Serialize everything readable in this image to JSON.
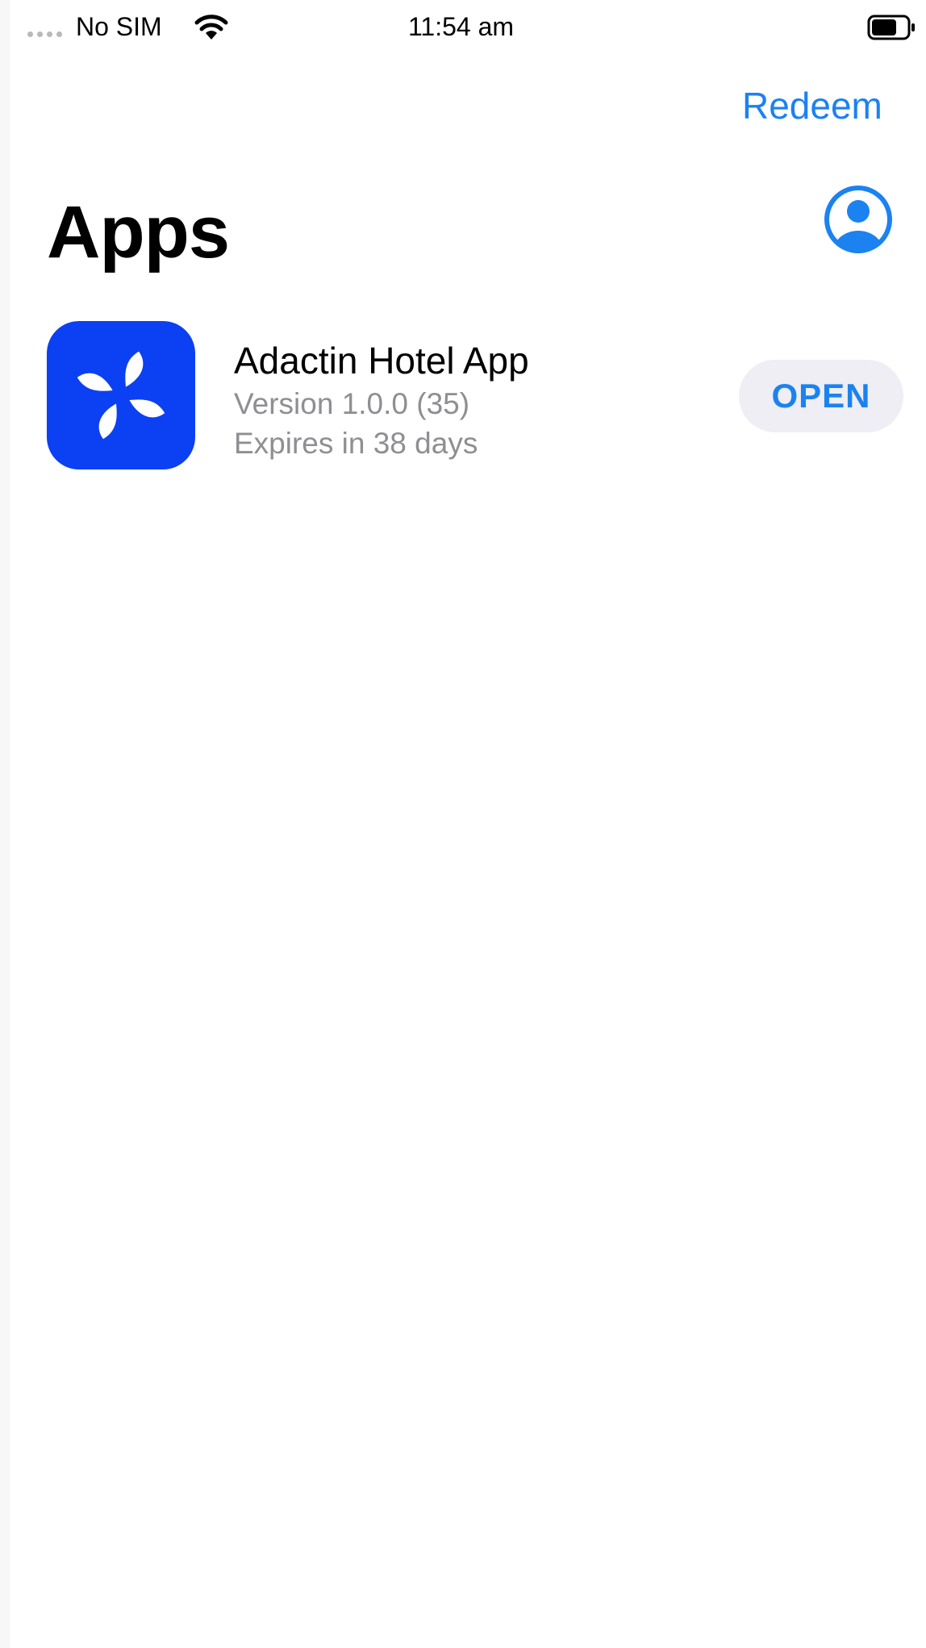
{
  "status_bar": {
    "carrier": "No SIM",
    "time": "11:54 am",
    "icons": [
      "signal-dots-icon",
      "wifi-icon",
      "battery-icon"
    ]
  },
  "nav": {
    "redeem_label": "Redeem",
    "account_icon": "person-circle-icon"
  },
  "page": {
    "title": "Apps"
  },
  "apps": [
    {
      "name": "Adactin Hotel App",
      "version": "Version 1.0.0 (35)",
      "expiry": "Expires in 38 days",
      "action_label": "OPEN",
      "icon": "adactin-app-icon"
    }
  ],
  "colors": {
    "accent": "#1b82f0",
    "app_icon_bg": "#0c40f3",
    "secondary_text": "#8e8e93",
    "button_bg": "#eeeef4"
  }
}
